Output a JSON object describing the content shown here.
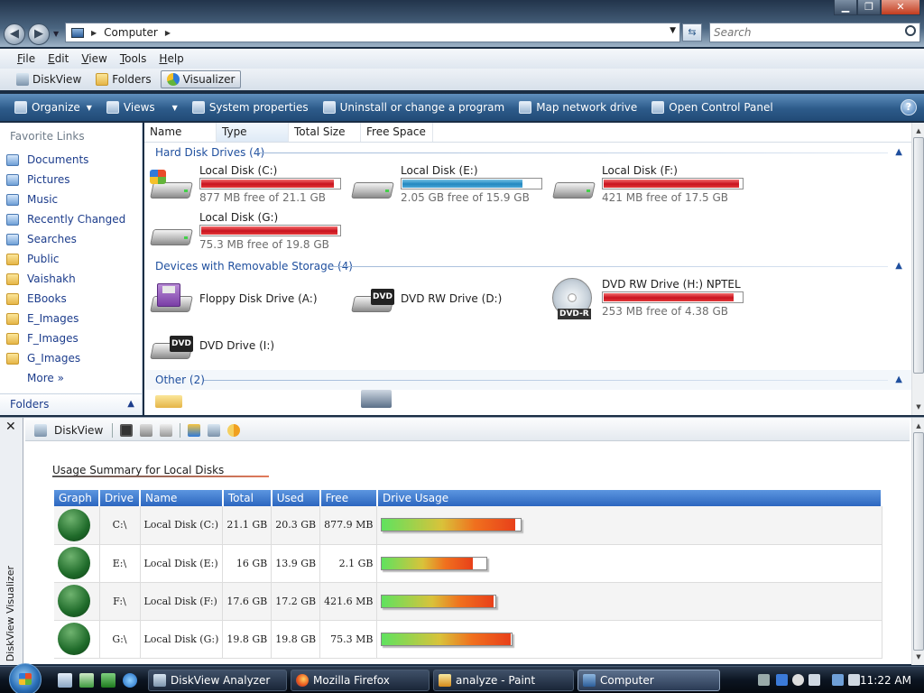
{
  "window": {
    "address": "Computer",
    "search_placeholder": "Search",
    "min_glyph": "▁",
    "max_glyph": "❐",
    "close_glyph": "✕"
  },
  "menu": [
    "File",
    "Edit",
    "View",
    "Tools",
    "Help"
  ],
  "toolbar2": [
    {
      "label": "DiskView",
      "icon": "diskview-icon"
    },
    {
      "label": "Folders",
      "icon": "folders-icon"
    },
    {
      "label": "Visualizer",
      "icon": "visualizer-icon",
      "active": true
    }
  ],
  "commandbar": [
    {
      "label": "Organize",
      "icon": "organize-icon",
      "dropdown": true
    },
    {
      "label": "Views",
      "icon": "views-icon",
      "dropdown": true
    },
    {
      "label": "System properties",
      "icon": "system-properties-icon"
    },
    {
      "label": "Uninstall or change a program",
      "icon": "uninstall-icon"
    },
    {
      "label": "Map network drive",
      "icon": "network-drive-icon"
    },
    {
      "label": "Open Control Panel",
      "icon": "control-panel-icon"
    }
  ],
  "help_glyph": "?",
  "sidebar": {
    "title": "Favorite Links",
    "items": [
      {
        "label": "Documents",
        "icon": "documents-icon"
      },
      {
        "label": "Pictures",
        "icon": "pictures-icon"
      },
      {
        "label": "Music",
        "icon": "music-icon"
      },
      {
        "label": "Recently Changed",
        "icon": "recently-changed-icon"
      },
      {
        "label": "Searches",
        "icon": "searches-icon"
      },
      {
        "label": "Public",
        "icon": "folder-icon"
      },
      {
        "label": "Vaishakh",
        "icon": "folder-icon"
      },
      {
        "label": "EBooks",
        "icon": "folder-icon"
      },
      {
        "label": "E_Images",
        "icon": "folder-icon"
      },
      {
        "label": "F_Images",
        "icon": "folder-icon"
      },
      {
        "label": "G_Images",
        "icon": "folder-icon"
      }
    ],
    "more": "More",
    "more_glyph": "»",
    "folders": "Folders"
  },
  "columns": [
    "Name",
    "Type",
    "Total Size",
    "Free Space"
  ],
  "groups": {
    "hdd": {
      "title": "Hard Disk Drives (4)",
      "items": [
        {
          "name": "Local Disk (C:)",
          "free": "877 MB free of 21.1 GB",
          "used_fraction": 0.96,
          "bar": "red"
        },
        {
          "name": "Local Disk (E:)",
          "free": "2.05 GB free of 15.9 GB",
          "used_fraction": 0.87,
          "bar": "blue"
        },
        {
          "name": "Local Disk (F:)",
          "free": "421 MB free of 17.5 GB",
          "used_fraction": 0.98,
          "bar": "red"
        },
        {
          "name": "Local Disk (G:)",
          "free": "75.3 MB free of 19.8 GB",
          "used_fraction": 0.99,
          "bar": "red"
        }
      ]
    },
    "removable": {
      "title": "Devices with Removable Storage (4)",
      "items": [
        {
          "name": "Floppy Disk Drive (A:)"
        },
        {
          "name": "DVD RW Drive (D:)",
          "badge": "DVD"
        },
        {
          "name": "DVD RW Drive (H:) NPTEL",
          "free": "253 MB free of 4.38 GB",
          "used_fraction": 0.94,
          "badge": "DVD-R"
        },
        {
          "name": "DVD Drive (I:)",
          "badge": "DVD"
        }
      ]
    },
    "other": {
      "title": "Other (2)"
    }
  },
  "diskview": {
    "side_label": "DiskView Visualizer",
    "close_glyph": "✕",
    "tool_label": "DiskView",
    "summary_title": "Usage Summary for Local Disks",
    "headers": [
      "Graph",
      "Drive",
      "Name",
      "Total",
      "Used",
      "Free",
      "Drive Usage"
    ],
    "rows": [
      {
        "drive": "C:\\",
        "name": "Local Disk (C:)",
        "total": "21.1 GB",
        "used": "20.3 GB",
        "free": "877.9 MB",
        "usage_fraction": 0.96
      },
      {
        "drive": "E:\\",
        "name": "Local Disk (E:)",
        "total": "16 GB",
        "used": "13.9 GB",
        "free": "2.1 GB",
        "usage_fraction": 0.87
      },
      {
        "drive": "F:\\",
        "name": "Local Disk (F:)",
        "total": "17.6 GB",
        "used": "17.2 GB",
        "free": "421.6 MB",
        "usage_fraction": 0.98
      },
      {
        "drive": "G:\\",
        "name": "Local Disk (G:)",
        "total": "19.8 GB",
        "used": "19.8 GB",
        "free": "75.3 MB",
        "usage_fraction": 0.99
      }
    ]
  },
  "taskbar": {
    "tasks": [
      {
        "label": "DiskView Analyzer",
        "icon": "diskview-icon"
      },
      {
        "label": "Mozilla Firefox",
        "icon": "firefox-icon"
      },
      {
        "label": "analyze - Paint",
        "icon": "paint-icon"
      },
      {
        "label": "Computer",
        "icon": "computer-icon",
        "active": true
      }
    ],
    "clock": "11:22 AM"
  },
  "colors": {
    "accent": "#2d5b8a",
    "link": "#1d3d8c",
    "bar_red": "#c8121e",
    "bar_blue": "#2288c0"
  }
}
